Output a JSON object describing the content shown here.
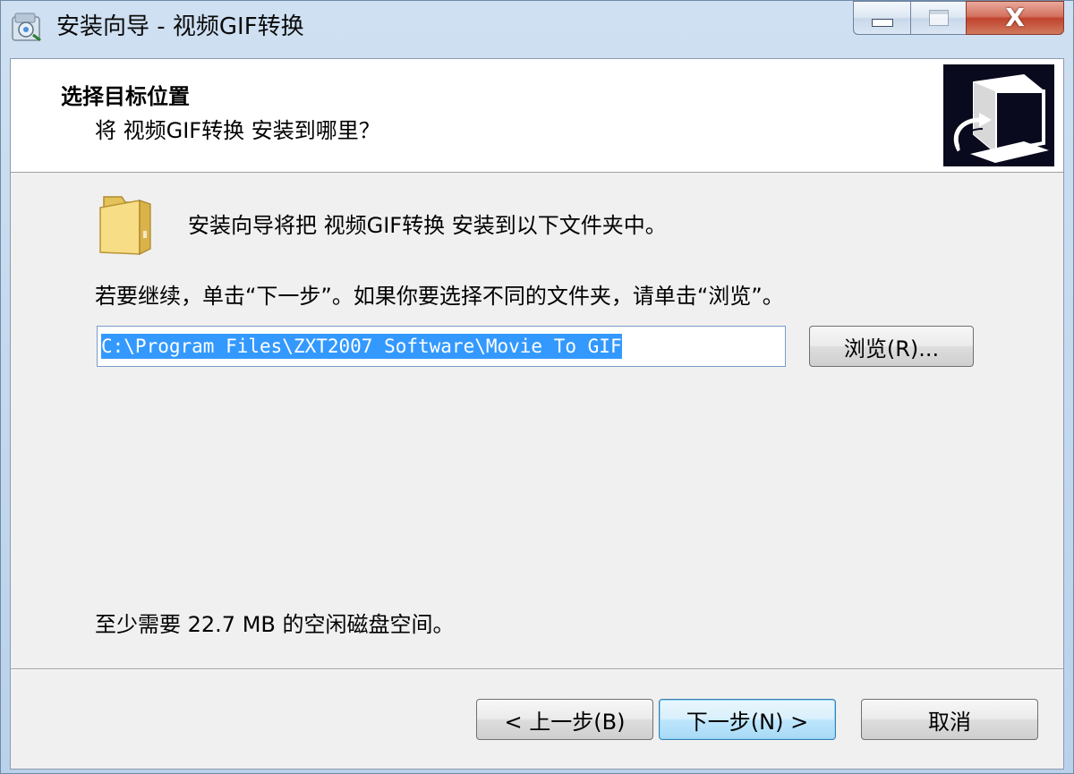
{
  "window": {
    "title": "安装向导 - 视频GIF转换",
    "close_glyph": "X"
  },
  "header": {
    "title": "选择目标位置",
    "subtitle": "将 视频GIF转换 安装到哪里？"
  },
  "main": {
    "intro": "安装向导将把 视频GIF转换 安装到以下文件夹中。",
    "continue_hint": "若要继续，单击“下一步”。如果你要选择不同的文件夹，请单击“浏览”。",
    "install_path": "C:\\Program Files\\ZXT2007 Software\\Movie To GIF",
    "browse_label": "浏览(R)...",
    "space_required": "至少需要 22.7 MB 的空闲磁盘空间。"
  },
  "buttons": {
    "back": "< 上一步(B)",
    "next": "下一步(N) >",
    "cancel": "取消"
  },
  "icons": {
    "app": "installer-app-icon",
    "header": "computer-install-icon",
    "folder": "folder-icon"
  },
  "colors": {
    "selection": "#3399ff",
    "dialog_bg": "#f0f0f0",
    "close_button": "#c0432d"
  }
}
